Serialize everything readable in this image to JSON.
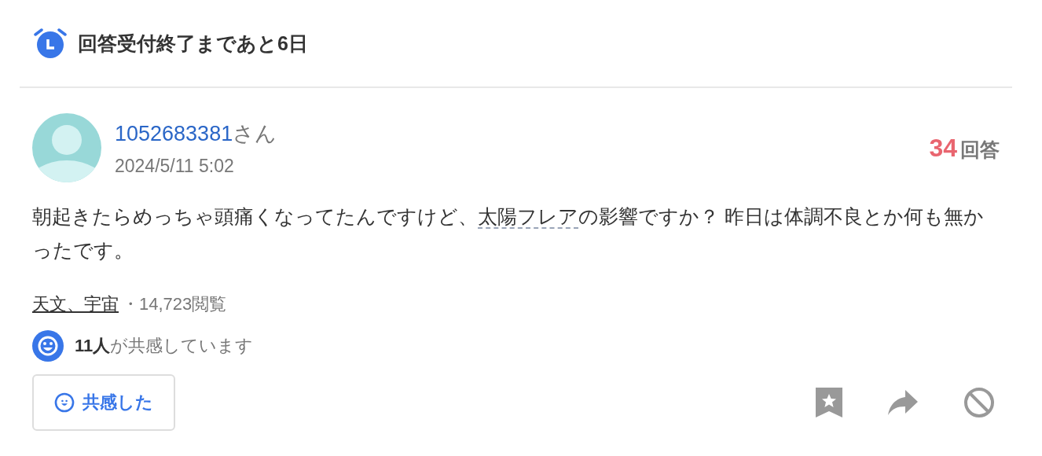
{
  "deadline": {
    "text": "回答受付終了まであと6日"
  },
  "question": {
    "user_id": "1052683381",
    "user_suffix": "さん",
    "date": "2024/5/11 5:02",
    "answer_count": "34",
    "answer_label": "回答",
    "body_before": "朝起きたらめっちゃ頭痛くなってたんですけど、",
    "body_link": "太陽フレア",
    "body_after": "の影響ですか？ 昨日は体調不良とか何も無かったです。",
    "category": "天文、宇宙",
    "views": "・14,723閲覧",
    "empathy_count": "11人",
    "empathy_text": "が共感しています",
    "empathy_button": "共感した"
  }
}
